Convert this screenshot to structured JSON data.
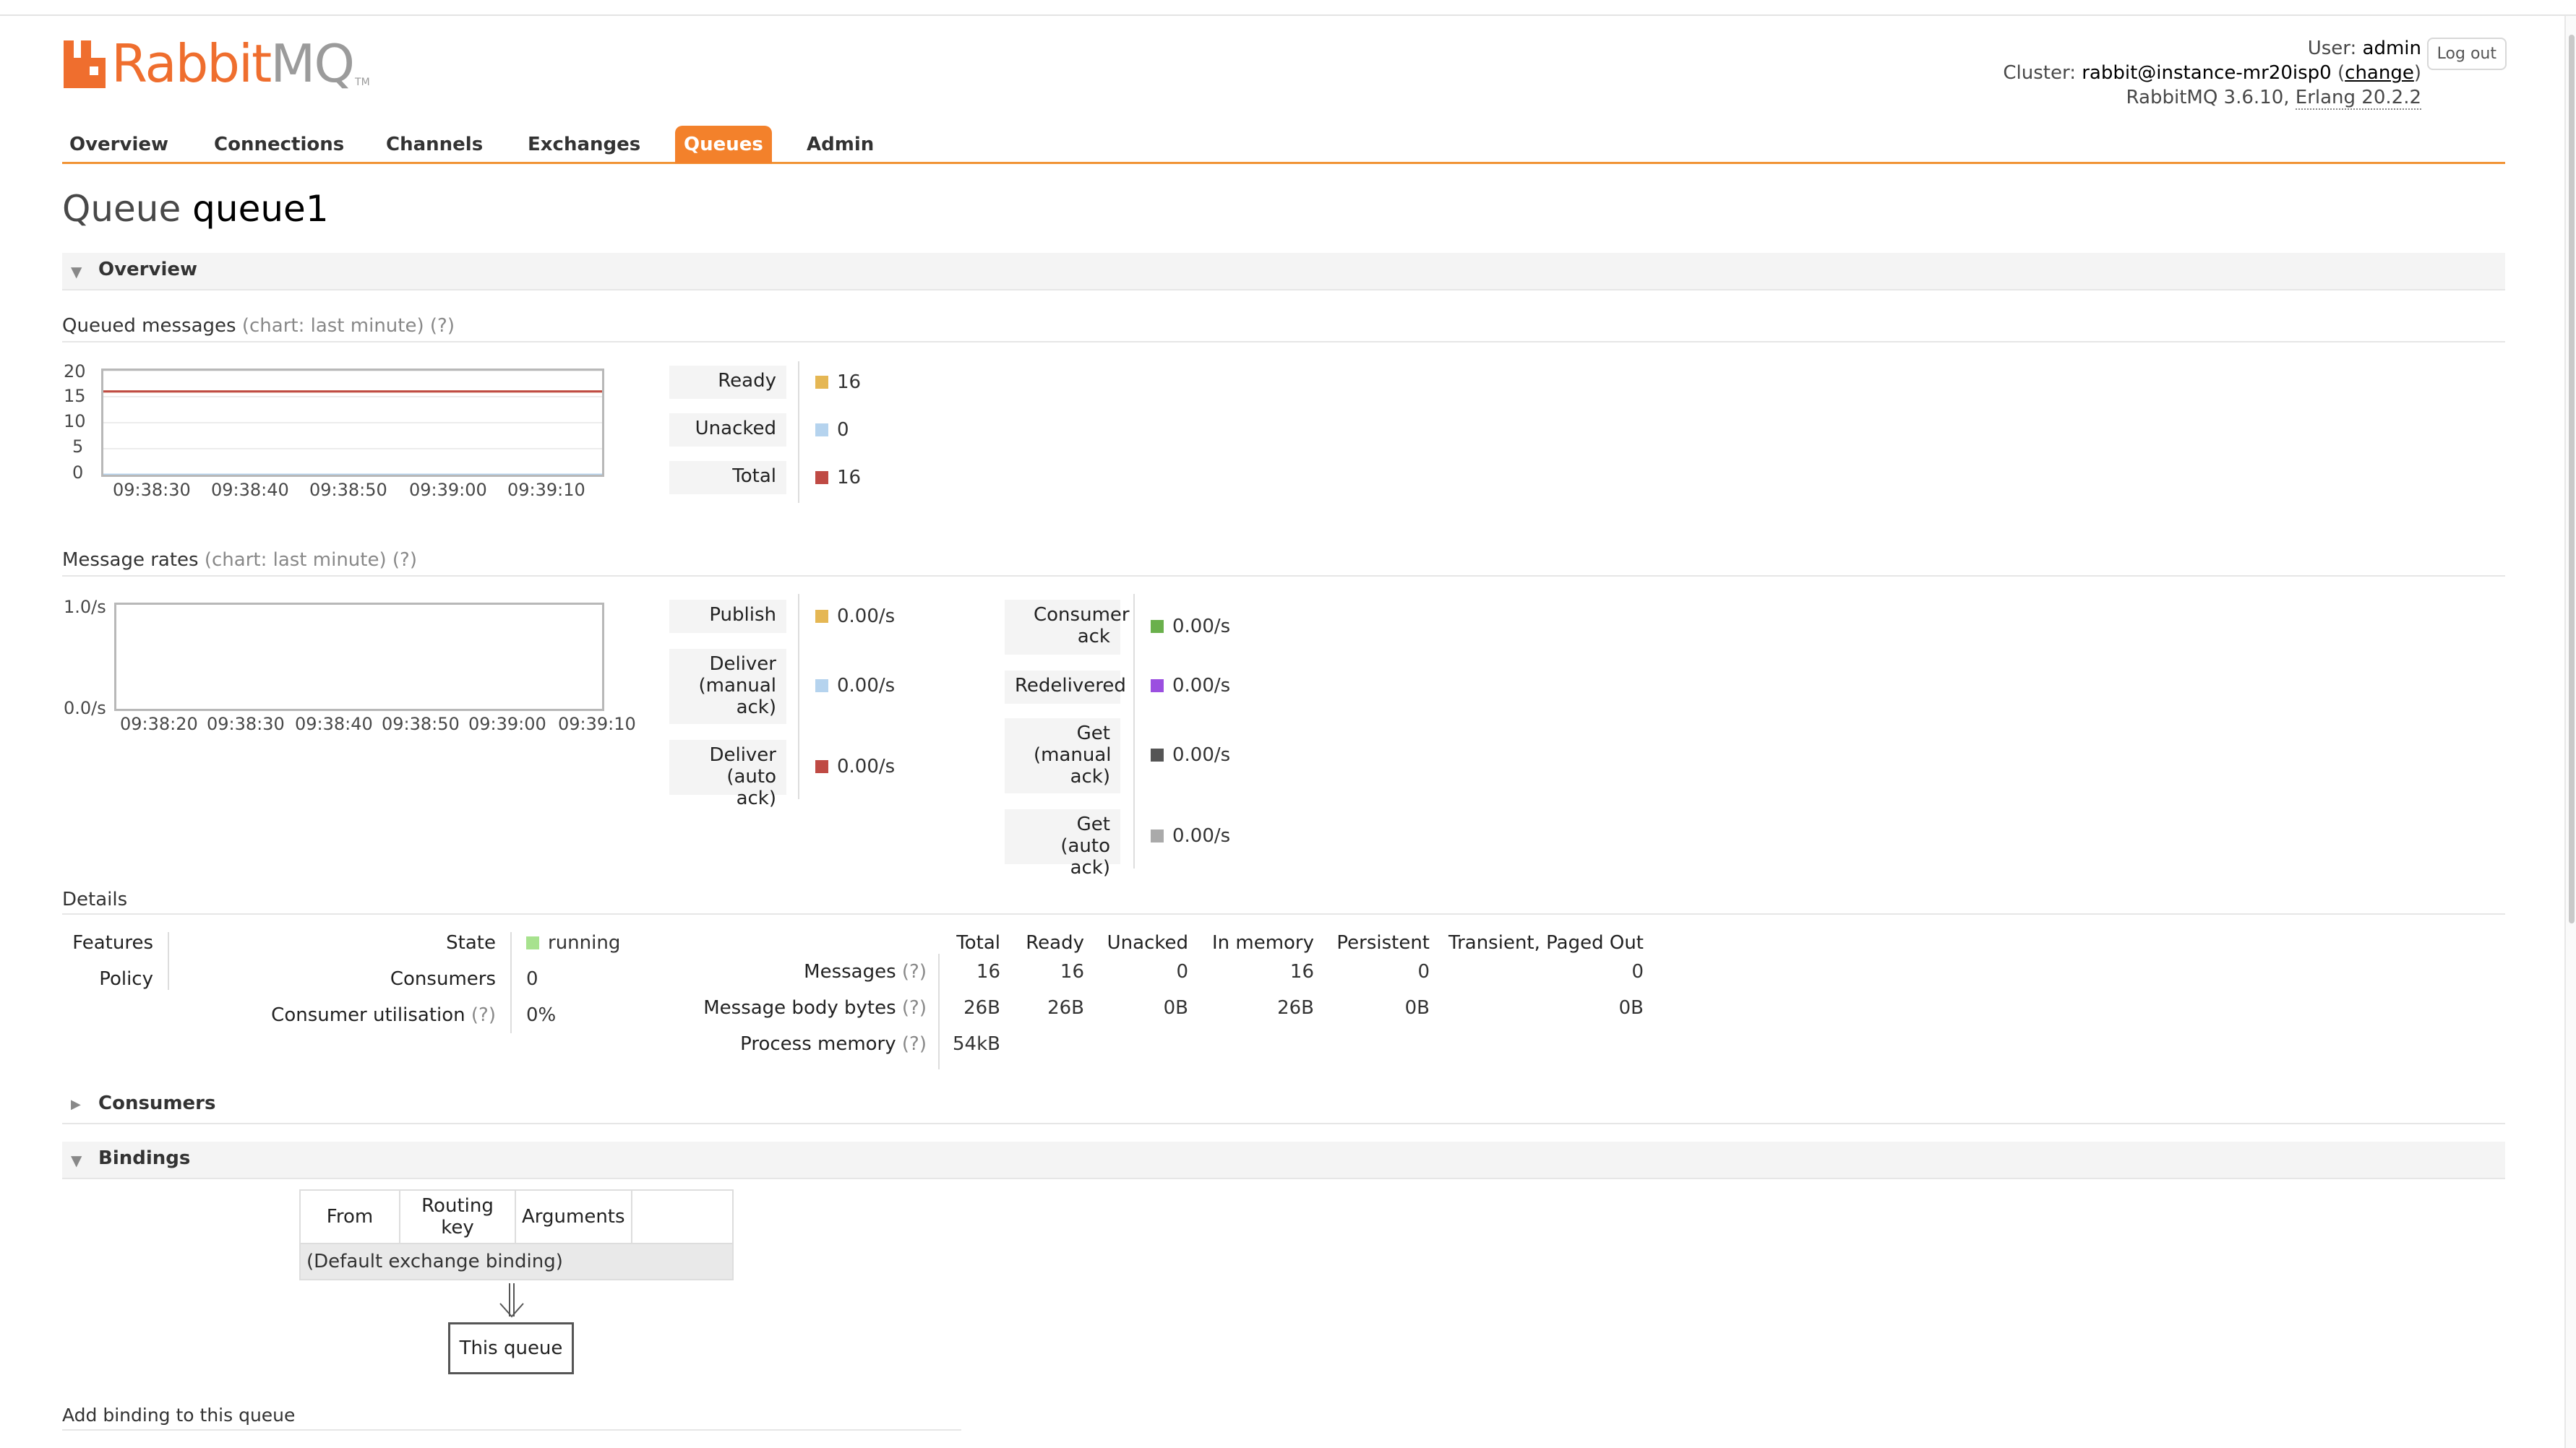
{
  "app": {
    "logo_rabbit": "Rabbit",
    "logo_mq": "MQ",
    "logo_tm": "TM"
  },
  "header": {
    "user_label": "User:",
    "user": "admin",
    "cluster_label": "Cluster:",
    "cluster": "rabbit@instance-mr20isp0",
    "change_link": "change",
    "version": "RabbitMQ 3.6.10,",
    "erlang": "Erlang 20.2.2",
    "logout": "Log out"
  },
  "nav": {
    "tabs": [
      {
        "label": "Overview"
      },
      {
        "label": "Connections"
      },
      {
        "label": "Channels"
      },
      {
        "label": "Exchanges"
      },
      {
        "label": "Queues"
      },
      {
        "label": "Admin"
      }
    ],
    "active": "Queues"
  },
  "page": {
    "title_prefix": "Queue",
    "queue_name": "queue1"
  },
  "overview": {
    "section_title": "Overview",
    "queued": {
      "heading": "Queued messages",
      "chart_note": "(chart: last minute)",
      "help": "(?)",
      "legend": [
        {
          "label": "Ready",
          "value": "16",
          "color": "#e5b754"
        },
        {
          "label": "Unacked",
          "value": "0",
          "color": "#b5d3ee"
        },
        {
          "label": "Total",
          "value": "16",
          "color": "#bf4a44"
        }
      ]
    },
    "rates": {
      "heading": "Message rates",
      "chart_note": "(chart: last minute)",
      "help": "(?)",
      "legend_left": [
        {
          "label": "Publish",
          "value": "0.00/s",
          "color": "#e5b754"
        },
        {
          "label": "Deliver (manual ack)",
          "value": "0.00/s",
          "color": "#b5d3ee"
        },
        {
          "label": "Deliver (auto ack)",
          "value": "0.00/s",
          "color": "#bf4a44"
        }
      ],
      "legend_right": [
        {
          "label": "Consumer ack",
          "value": "0.00/s",
          "color": "#6ab04c"
        },
        {
          "label": "Redelivered",
          "value": "0.00/s",
          "color": "#9b4fe0"
        },
        {
          "label": "Get (manual ack)",
          "value": "0.00/s",
          "color": "#555555"
        },
        {
          "label": "Get (auto ack)",
          "value": "0.00/s",
          "color": "#aaaaaa"
        }
      ]
    },
    "details": {
      "heading": "Details",
      "features_label": "Features",
      "policy_label": "Policy",
      "state_label": "State",
      "state_value": "running",
      "state_color": "#a7e28e",
      "consumers_label": "Consumers",
      "consumers_value": "0",
      "util_label": "Consumer utilisation",
      "util_help": "(?)",
      "util_value": "0%",
      "columns": [
        "Total",
        "Ready",
        "Unacked",
        "In memory",
        "Persistent",
        "Transient, Paged Out"
      ],
      "rows": [
        {
          "label": "Messages",
          "help": "(?)",
          "values": [
            "16",
            "16",
            "0",
            "16",
            "0",
            "0"
          ]
        },
        {
          "label": "Message body bytes",
          "help": "(?)",
          "values": [
            "26B",
            "26B",
            "0B",
            "26B",
            "0B",
            "0B"
          ]
        },
        {
          "label": "Process memory",
          "help": "(?)",
          "values": [
            "54kB",
            "",
            "",
            "",
            "",
            ""
          ]
        }
      ]
    }
  },
  "consumers": {
    "section_title": "Consumers"
  },
  "bindings": {
    "section_title": "Bindings",
    "columns": [
      "From",
      "Routing key",
      "Arguments",
      ""
    ],
    "default_binding": "(Default exchange binding)",
    "this_queue": "This queue",
    "add_heading": "Add binding to this queue"
  },
  "chart_data": [
    {
      "type": "line",
      "ylim": [
        0,
        20
      ],
      "yticks": [
        "20",
        "15",
        "10",
        "5",
        "0"
      ],
      "x": [
        "09:38:30",
        "09:38:40",
        "09:38:50",
        "09:39:00",
        "09:39:10"
      ],
      "series": [
        {
          "name": "Ready",
          "color": "#e5b754",
          "values": [
            16,
            16,
            16,
            16,
            16
          ]
        },
        {
          "name": "Unacked",
          "color": "#b5d3ee",
          "values": [
            0,
            0,
            0,
            0,
            0
          ]
        },
        {
          "name": "Total",
          "color": "#bf4a44",
          "values": [
            16,
            16,
            16,
            16,
            16
          ]
        }
      ],
      "grid": true
    },
    {
      "type": "line",
      "ylim": [
        0,
        1
      ],
      "yticks": [
        "1.0/s",
        "0.0/s"
      ],
      "x": [
        "09:38:20",
        "09:38:30",
        "09:38:40",
        "09:38:50",
        "09:39:00",
        "09:39:10"
      ],
      "series": [],
      "grid": false
    }
  ]
}
